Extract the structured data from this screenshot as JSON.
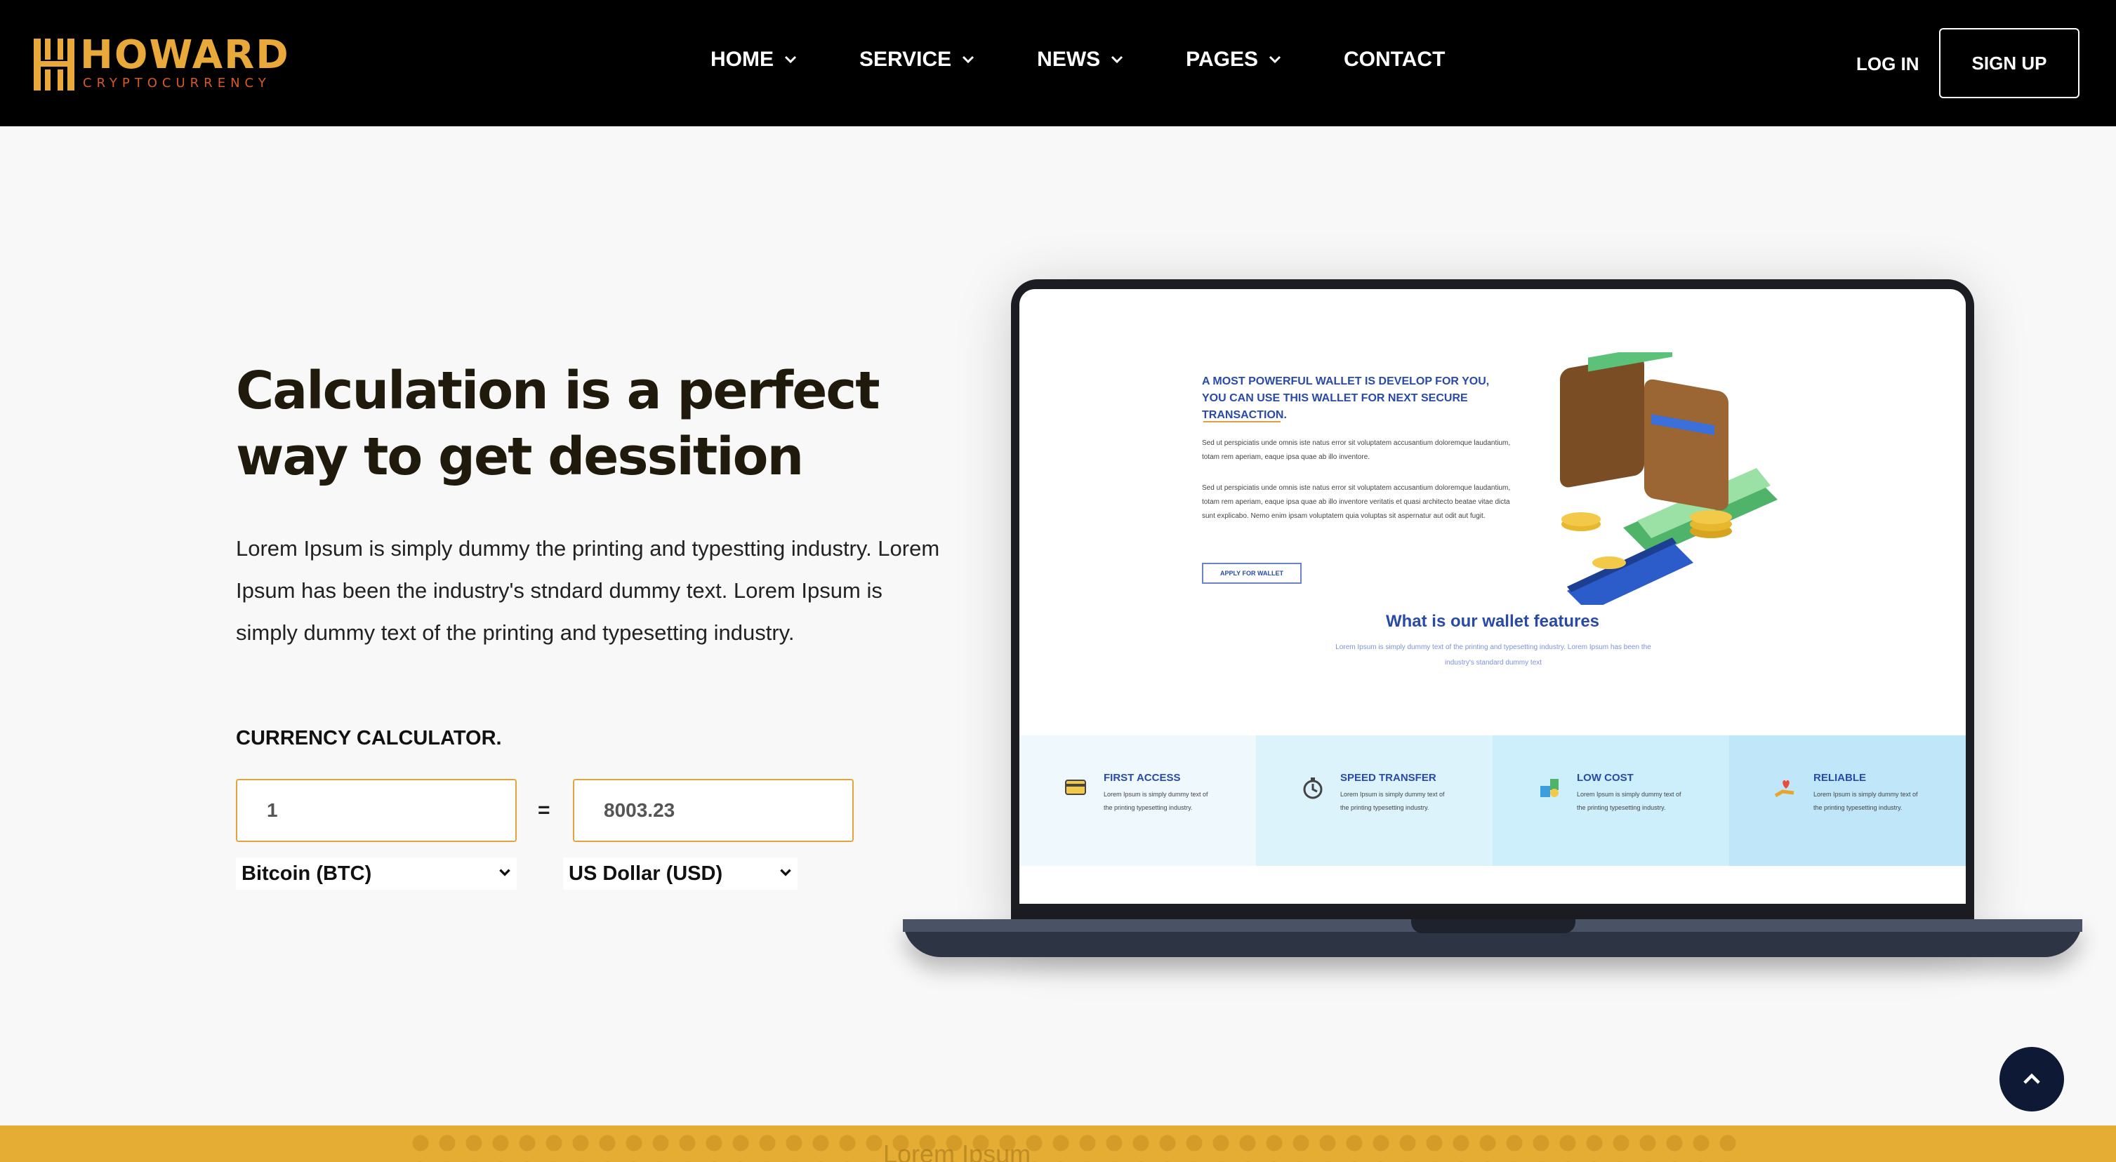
{
  "brand": {
    "name": "HOWARD",
    "tagline": "CRYPTOCURRENCY",
    "primary_color": "#e8a93a",
    "accent_color": "#d8592b"
  },
  "nav": {
    "items": [
      {
        "label": "HOME",
        "has_dropdown": true
      },
      {
        "label": "SERVICE",
        "has_dropdown": true
      },
      {
        "label": "NEWS",
        "has_dropdown": true
      },
      {
        "label": "PAGES",
        "has_dropdown": true
      },
      {
        "label": "CONTACT",
        "has_dropdown": false
      }
    ],
    "login_label": "LOG IN",
    "signup_label": "SIGN UP"
  },
  "hero": {
    "title": "Calculation is a perfect way to get dessition",
    "description": "Lorem Ipsum is simply dummy the printing and typestting industry. Lorem Ipsum has been the industry's stndard dummy text. Lorem Ipsum is simply dummy text of the printing and typesetting industry."
  },
  "calculator": {
    "label": "CURRENCY CALCULATOR.",
    "from_value": "1",
    "equals": "=",
    "to_value": "8003.23",
    "from_currency": "Bitcoin (BTC)",
    "to_currency": "US Dollar (USD)"
  },
  "laptop_screen": {
    "headline_line1": "A MOST POWERFUL WALLET IS DEVELOP FOR YOU,",
    "headline_line2": "YOU CAN USE THIS WALLET FOR NEXT SECURE TRANSACTION.",
    "para1": "Sed ut perspiciatis unde omnis iste natus error sit voluptatem accusantium doloremque laudantium, totam rem aperiam, eaque ipsa quae ab illo inventore.",
    "para2": "Sed ut perspiciatis unde omnis iste natus error sit voluptatem accusantium doloremque laudantium, totam rem aperiam, eaque ipsa quae ab illo inventore veritatis et quasi architecto beatae vitae dicta sunt explicabo. Nemo enim ipsam voluptatem quia voluptas sit aspernatur aut odit aut fugit.",
    "button": "APPLY FOR WALLET",
    "features_title": "What is our wallet features",
    "features_sub": "Lorem Ipsum is simply dummy text of the printing and typesetting industry. Lorem Ipsum has been the industry's standard dummy text",
    "cards": [
      {
        "title": "FIRST ACCESS",
        "text": "Lorem Ipsum is simply dummy text of the printing typesetting industry.",
        "bg": "#eef8fd",
        "icon": "card-icon"
      },
      {
        "title": "SPEED TRANSFER",
        "text": "Lorem Ipsum is simply dummy text of the printing typesetting industry.",
        "bg": "#dcf3fc",
        "icon": "stopwatch-icon"
      },
      {
        "title": "LOW COST",
        "text": "Lorem Ipsum is simply dummy text of the printing typesetting industry.",
        "bg": "#cdeefb",
        "icon": "coins-icon"
      },
      {
        "title": "RELIABLE",
        "text": "Lorem Ipsum is simply dummy text of the printing typesetting industry.",
        "bg": "#bfe7f9",
        "icon": "heart-hand-icon"
      }
    ]
  },
  "footer_strip": {
    "text": "Lorem Ipsum",
    "color": "#e5ad33"
  }
}
